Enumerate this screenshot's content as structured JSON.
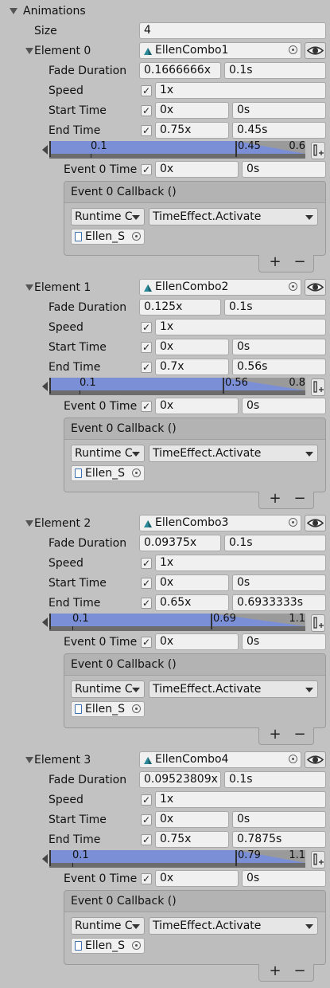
{
  "animations": {
    "label": "Animations",
    "size_label": "Size",
    "size_value": "4",
    "labels": {
      "fade_duration": "Fade Duration",
      "speed": "Speed",
      "start_time": "Start Time",
      "end_time": "End Time",
      "event_time": "Event 0 Time",
      "callback_header": "Event 0 Callback ()",
      "runtime": "Runtime C",
      "function": "TimeEffect.Activate",
      "object": "Ellen_S",
      "plus": "+",
      "minus": "−",
      "check": "✓"
    },
    "elements": [
      {
        "label": "Element 0",
        "clip": "EllenCombo1",
        "fade_x": "0.1666666x",
        "fade_s": "0.1s",
        "speed": "1x",
        "start_x": "0x",
        "start_s": "0s",
        "end_x": "0.75x",
        "end_s": "0.45s",
        "tl_left": "0.1",
        "tl_mark": "0.45",
        "tl_right": "0.6",
        "tl_mark_fraction": 0.75,
        "event_x": "0x",
        "event_s": "0s"
      },
      {
        "label": "Element 1",
        "clip": "EllenCombo2",
        "fade_x": "0.125x",
        "fade_s": "0.1s",
        "speed": "1x",
        "start_x": "0x",
        "start_s": "0s",
        "end_x": "0.7x",
        "end_s": "0.56s",
        "tl_left": "0.1",
        "tl_mark": "0.56",
        "tl_right": "0.8",
        "tl_mark_fraction": 0.7,
        "event_x": "0x",
        "event_s": "0s"
      },
      {
        "label": "Element 2",
        "clip": "EllenCombo3",
        "fade_x": "0.09375x",
        "fade_s": "0.1s",
        "speed": "1x",
        "start_x": "0x",
        "start_s": "0s",
        "end_x": "0.65x",
        "end_s": "0.6933333s",
        "tl_left": "0.1",
        "tl_mark": "0.69",
        "tl_right": "1.1",
        "tl_mark_fraction": 0.65,
        "event_x": "0x",
        "event_s": "0s"
      },
      {
        "label": "Element 3",
        "clip": "EllenCombo4",
        "fade_x": "0.09523809x",
        "fade_s": "0.1s",
        "speed": "1x",
        "start_x": "0x",
        "start_s": "0s",
        "end_x": "0.75x",
        "end_s": "0.7875s",
        "tl_left": "0.1",
        "tl_mark": "0.79",
        "tl_right": "1.1",
        "tl_mark_fraction": 0.75,
        "event_x": "0x",
        "event_s": "0s"
      }
    ]
  }
}
